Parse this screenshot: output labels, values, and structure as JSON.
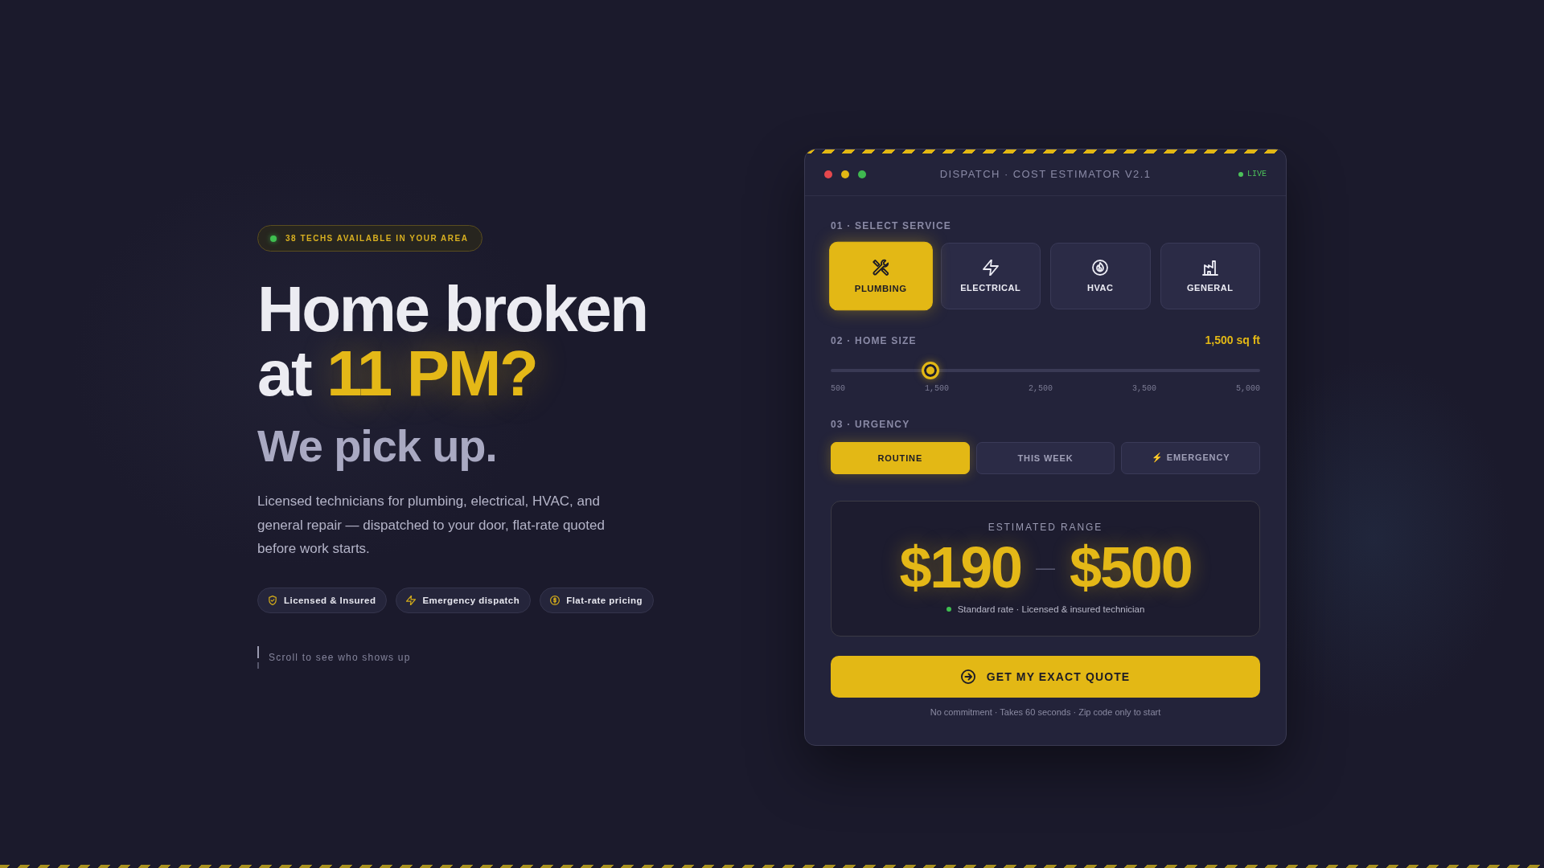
{
  "badge": {
    "text": "38 TECHS AVAILABLE IN YOUR AREA"
  },
  "headline": {
    "line_1": "Home broken",
    "line_2": "at",
    "highlight": "11 PM?"
  },
  "subheadline": "We pick up.",
  "description": "Licensed technicians for plumbing, electrical, HVAC, and general repair — dispatched to your door, flat-rate quoted before work starts.",
  "features": [
    {
      "label": "Licensed & Insured"
    },
    {
      "label": "Emergency dispatch"
    },
    {
      "label": "Flat-rate pricing"
    }
  ],
  "scroll_hint": "Scroll to see who shows up",
  "estimator": {
    "title": "DISPATCH · COST ESTIMATOR V2.1",
    "status": "LIVE",
    "service_label": "01 · SELECT SERVICE",
    "services": [
      {
        "label": "PLUMBING",
        "selected": true
      },
      {
        "label": "ELECTRICAL",
        "selected": false
      },
      {
        "label": "HVAC",
        "selected": false
      },
      {
        "label": "GENERAL",
        "selected": false
      }
    ],
    "size_label": "02 · HOME SIZE",
    "size_value": "1,500 sq ft",
    "size_slider": {
      "level": 0.22,
      "ticks": [
        "500",
        "1,500",
        "2,500",
        "3,500",
        "5,000"
      ]
    },
    "urgency_label": "03 · URGENCY",
    "urgency_options": [
      {
        "label": "ROUTINE",
        "selected": true
      },
      {
        "label": "THIS WEEK",
        "selected": false
      },
      {
        "label": "⚡ EMERGENCY",
        "selected": false
      }
    ],
    "estimate": {
      "label": "ESTIMATED RANGE",
      "low": "$190",
      "separator": "—",
      "high": "$500",
      "note": "Standard rate · Licensed & insured technician"
    },
    "cta": "GET MY EXACT QUOTE",
    "footnote": "No commitment · Takes 60 seconds · Zip code only to start"
  }
}
